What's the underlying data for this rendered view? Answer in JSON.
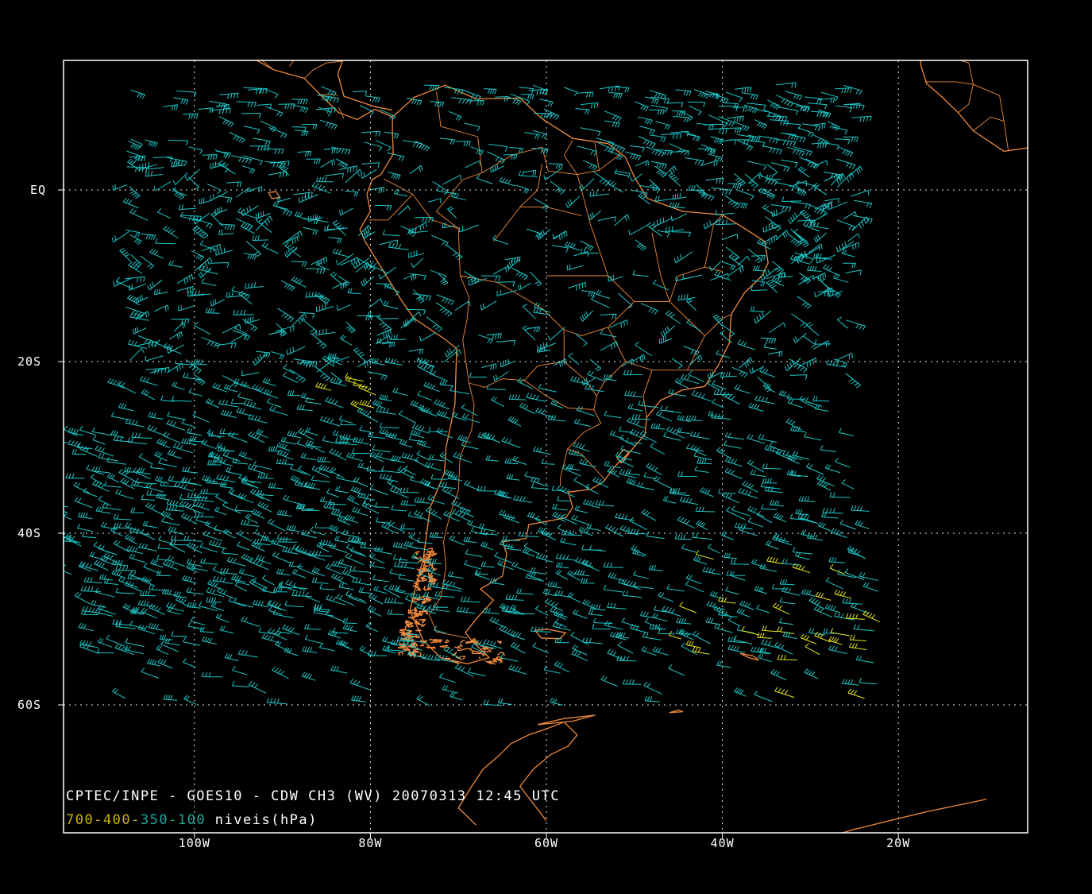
{
  "caption": {
    "title": "CPTEC/INPE - GOES10 - CDW CH3 (WV) 20070313 12:45 UTC",
    "legend_levels": [
      {
        "text": "700-400",
        "color": "#c8b400"
      },
      {
        "text": "-",
        "color": "#c8b400"
      },
      {
        "text": "350-100",
        "color": "#22a79e"
      },
      {
        "text": " niveis(hPa)",
        "color": "#ffffff"
      }
    ]
  },
  "axes": {
    "lat_labels": [
      {
        "lat": 0,
        "text": "EQ"
      },
      {
        "lat": -20,
        "text": "20S"
      },
      {
        "lat": -40,
        "text": "40S"
      },
      {
        "lat": -60,
        "text": "60S"
      }
    ],
    "lon_labels": [
      {
        "lon": -100,
        "text": "100W"
      },
      {
        "lon": -80,
        "text": "80W"
      },
      {
        "lon": -60,
        "text": "60W"
      },
      {
        "lon": -40,
        "text": "40W"
      },
      {
        "lon": -20,
        "text": "20W"
      }
    ],
    "grid": true
  },
  "colors": {
    "coast": "#f08a3c",
    "upper_winds": "#1ec8c8",
    "lower_winds": "#e6e619",
    "frame": "#ffffff",
    "grid": "#ffffff"
  }
}
